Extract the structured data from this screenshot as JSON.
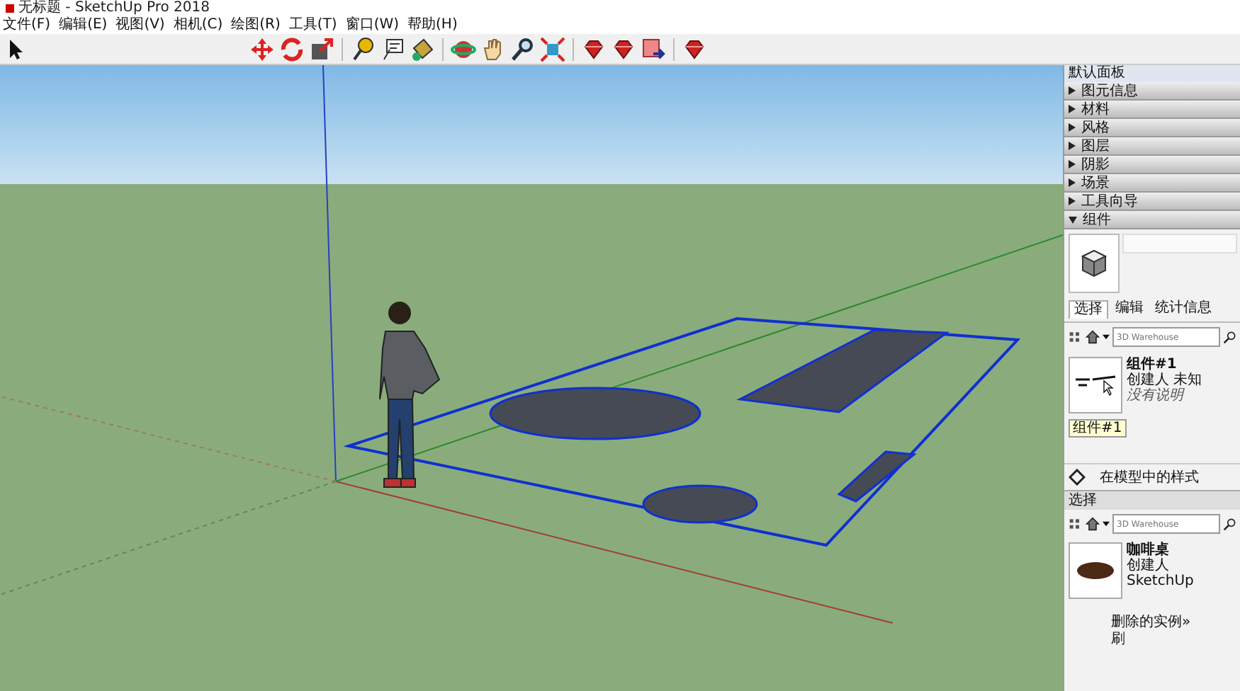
{
  "window": {
    "title": "无标题 - SketchUp Pro 2018"
  },
  "menu": [
    "文件(F)",
    "编辑(E)",
    "视图(V)",
    "相机(C)",
    "绘图(R)",
    "工具(T)",
    "窗口(W)",
    "帮助(H)"
  ],
  "toolbar": [
    {
      "kind": "select"
    },
    {
      "kind": "gap"
    },
    {
      "kind": "move"
    },
    {
      "kind": "rotate"
    },
    {
      "kind": "scale"
    },
    {
      "kind": "sep"
    },
    {
      "kind": "tape"
    },
    {
      "kind": "text"
    },
    {
      "kind": "paint"
    },
    {
      "kind": "sep"
    },
    {
      "kind": "orbit"
    },
    {
      "kind": "pan"
    },
    {
      "kind": "zoom"
    },
    {
      "kind": "extents"
    },
    {
      "kind": "sep"
    },
    {
      "kind": "gem"
    },
    {
      "kind": "gem"
    },
    {
      "kind": "share"
    },
    {
      "kind": "sep"
    },
    {
      "kind": "gem"
    }
  ],
  "tray": {
    "title": "默认面板",
    "sections": [
      {
        "label": "图元信息",
        "expanded": false
      },
      {
        "label": "材料",
        "expanded": false
      },
      {
        "label": "风格",
        "expanded": false
      },
      {
        "label": "图层",
        "expanded": false
      },
      {
        "label": "阴影",
        "expanded": false
      },
      {
        "label": "场景",
        "expanded": false
      },
      {
        "label": "工具向导",
        "expanded": false
      },
      {
        "label": "组件",
        "expanded": true
      }
    ],
    "tabs": [
      {
        "label": "选择",
        "selected": true
      },
      {
        "label": "编辑",
        "selected": false
      },
      {
        "label": "统计信息",
        "selected": false
      }
    ],
    "search": {
      "placeholder": "3D Warehouse"
    },
    "item": {
      "name": "组件#1",
      "creator": "创建人 未知",
      "description": "没有说明",
      "label": "组件#1"
    },
    "style_label": "在模型中的样式",
    "select_title": "选择",
    "search2": {
      "placeholder": "3D Warehouse"
    },
    "result": {
      "name": "咖啡桌",
      "creator": "创建人 SketchUp"
    },
    "footer": [
      "删除的实例»",
      "刷"
    ]
  }
}
